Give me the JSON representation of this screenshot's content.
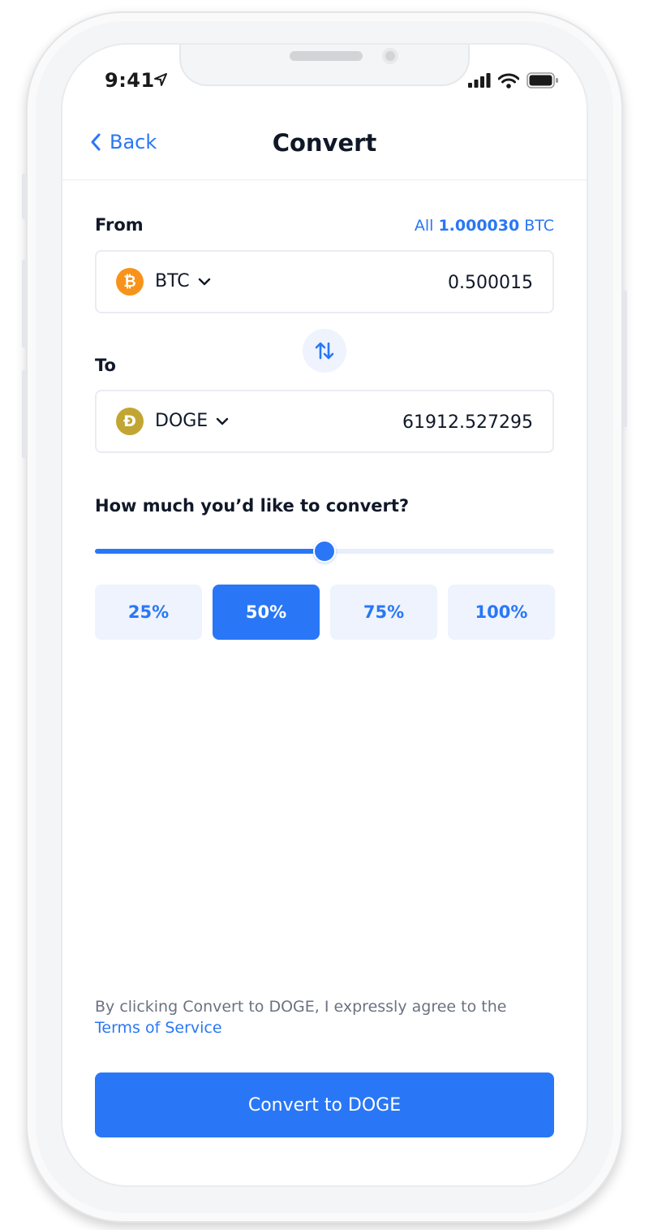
{
  "status_bar": {
    "time": "9:41",
    "icons": [
      "location-arrow-icon",
      "signal-icon",
      "wifi-icon",
      "battery-icon"
    ]
  },
  "header": {
    "back_label": "Back",
    "title": "Convert"
  },
  "from": {
    "label": "From",
    "all_label": "All",
    "balance": "1.000030",
    "balance_unit": "BTC",
    "coin": "BTC",
    "amount": "0.500015",
    "coin_color": "#f7931a",
    "coin_glyph": "₿"
  },
  "to": {
    "label": "To",
    "coin": "DOGE",
    "amount": "61912.527295",
    "coin_color": "#c2a633",
    "coin_glyph": "Ð"
  },
  "convert_amount": {
    "question": "How much you’d like to convert?",
    "slider_percent": 50,
    "options": [
      "25%",
      "50%",
      "75%",
      "100%"
    ],
    "selected": "50%"
  },
  "terms": {
    "text": "By clicking Convert to DOGE, I expressly agree to the",
    "link": "Terms of Service"
  },
  "cta": {
    "label": "Convert to DOGE"
  },
  "colors": {
    "accent": "#2977f6",
    "accent_light": "#eef3fd",
    "text": "#101828",
    "muted": "#6b7280"
  }
}
